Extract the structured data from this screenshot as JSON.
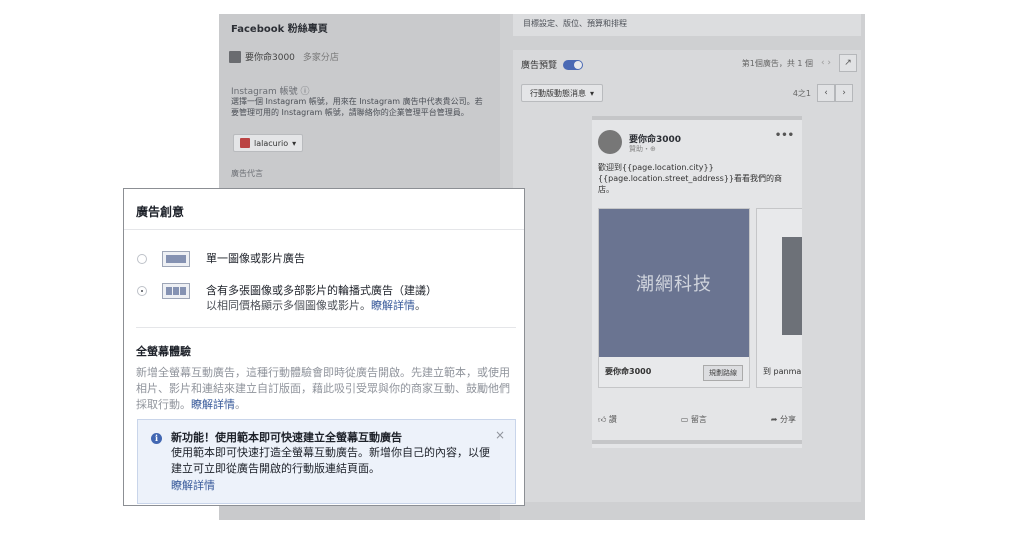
{
  "background": {
    "facebook_page_label": "Facebook 粉絲專頁",
    "page_name": "要你命3000",
    "page_sub": "多家分店",
    "instagram_label": "Instagram 帳號 ⓘ",
    "instagram_desc": "選擇一個 Instagram 帳號，用來在 Instagram 廣告中代表貴公司。若要管理可用的 Instagram 帳號，請聯絡你的企業管理平台管理員。",
    "instagram_account": "lalacurio",
    "ad_code_label": "廣告代言",
    "targeting_label": "目標設定、版位、預算和排程",
    "preview_label": "廣告預覽",
    "preview_count": "第1個廣告，共 1 個",
    "placement": "行動版動態消息",
    "page_indicator": "4之1",
    "post": {
      "poster": "要你命3000",
      "sponsored": "贊助・⊕",
      "text": "歡迎到{{page.location.city}} {{page.location.street_address}}看看我們的商店。",
      "card1_image_text": "潮網科技",
      "card1_name": "要你命3000",
      "card1_cta": "規劃路線",
      "card2_name": "到 panma",
      "like": "讚",
      "comment": "留言",
      "share": "分享"
    }
  },
  "modal": {
    "title": "廣告創意",
    "option1": "單一圖像或影片廣告",
    "option2": "含有多張圖像或多部影片的輪播式廣告（建議）",
    "option2_sub": "以相同價格顯示多個圖像或影片。",
    "learn_more": "瞭解詳情",
    "fullscreen_title": "全螢幕體驗",
    "fullscreen_desc": "新增全螢幕互動廣告，這種行動體驗會即時從廣告開啟。先建立範本，或使用相片、影片和連結來建立自訂版面，藉此吸引受眾與你的商家互動、鼓勵他們採取行動。",
    "fullscreen_link": "瞭解詳情",
    "notice_title": "新功能！使用範本即可快速建立全螢幕互動廣告",
    "notice_body": "使用範本即可快速打造全螢幕互動廣告。新增你自己的內容，以便建立可立即從廣告開啟的行動版連結頁面。",
    "notice_link": "瞭解詳情",
    "close": "×"
  }
}
